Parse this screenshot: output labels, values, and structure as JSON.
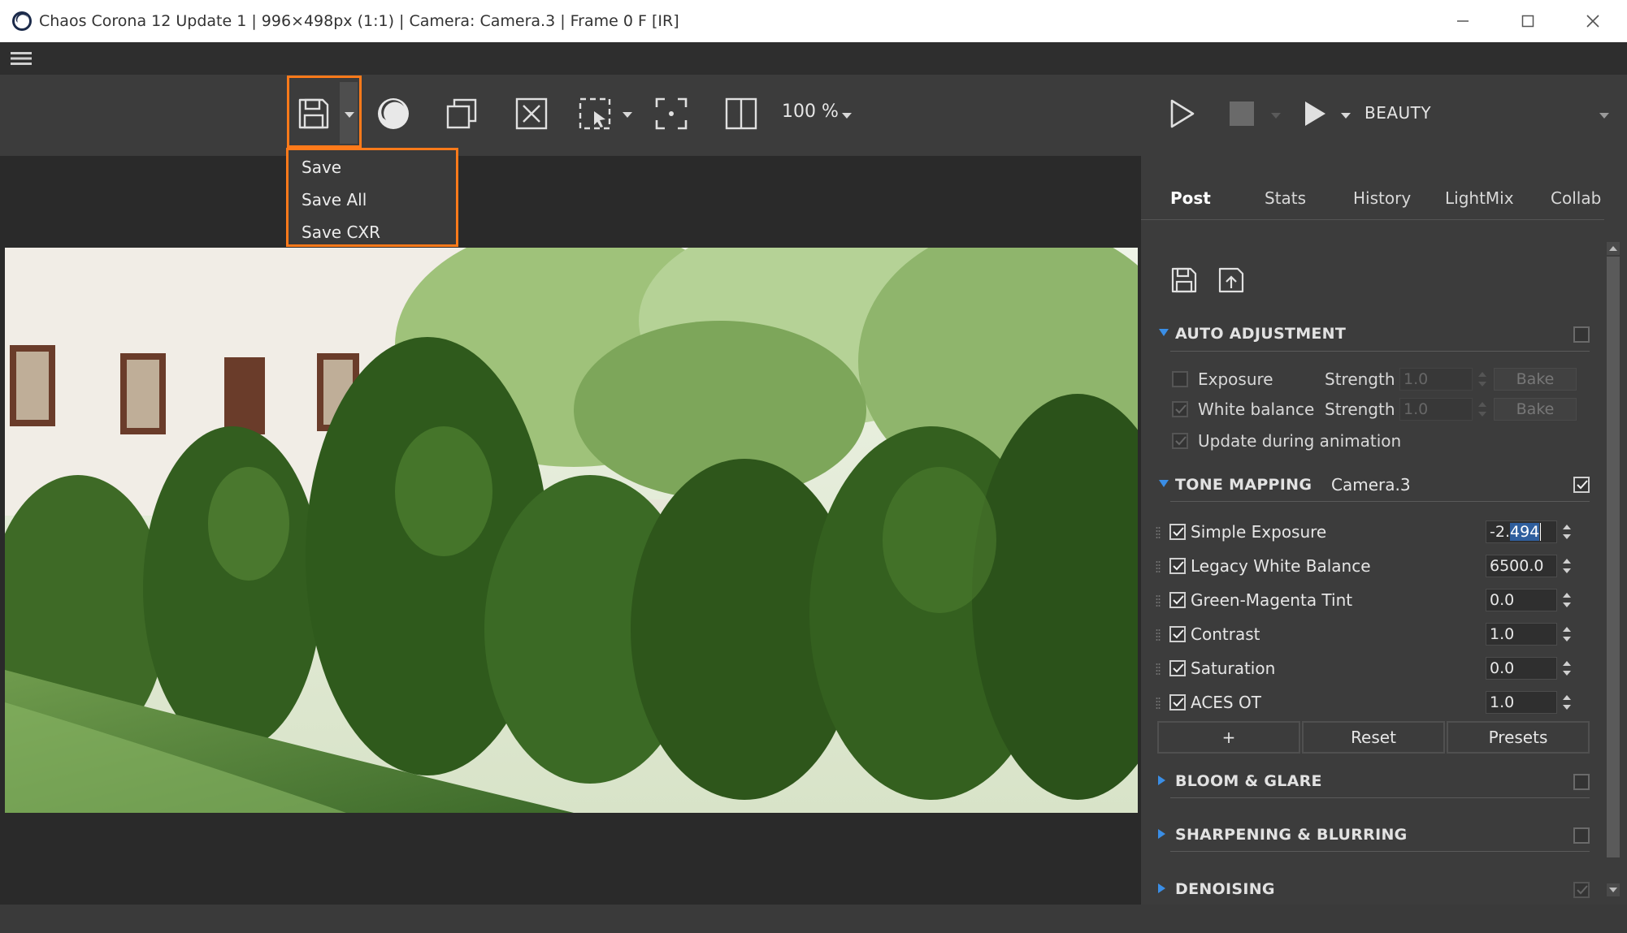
{
  "window": {
    "title": "Chaos Corona 12 Update 1 | 996×498px (1:1) | Camera: Camera.3 | Frame 0 F [IR]"
  },
  "toolbar": {
    "zoom": "100 %",
    "render_element": "BEAUTY"
  },
  "save_menu": {
    "items": [
      "Save",
      "Save All",
      "Save CXR"
    ]
  },
  "panel": {
    "tabs": [
      "Post",
      "Stats",
      "History",
      "LightMix",
      "Collab"
    ],
    "auto_adjustment": {
      "title": "AUTO ADJUSTMENT",
      "exposure_label": "Exposure",
      "white_balance_label": "White balance",
      "strength_label": "Strength",
      "exposure_strength": "1.0",
      "wb_strength": "1.0",
      "bake_label": "Bake",
      "update_label": "Update during animation"
    },
    "tone_mapping": {
      "title": "TONE MAPPING",
      "camera": "Camera.3",
      "operators": [
        {
          "label": "Simple Exposure",
          "value_pre": "-2.",
          "value_sel": "494"
        },
        {
          "label": "Legacy White Balance",
          "value": "6500.0"
        },
        {
          "label": "Green-Magenta Tint",
          "value": "0.0"
        },
        {
          "label": "Contrast",
          "value": "1.0"
        },
        {
          "label": "Saturation",
          "value": "0.0"
        },
        {
          "label": "ACES OT",
          "value": "1.0"
        }
      ],
      "add_label": "+",
      "reset_label": "Reset",
      "presets_label": "Presets"
    },
    "sections": {
      "bloom": "BLOOM & GLARE",
      "sharpen": "SHARPENING & BLURRING",
      "denoise": "DENOISING"
    }
  },
  "colors": {
    "highlight": "#ff7a1a",
    "accent_blue": "#3a8ee6",
    "selection": "#2f5f9e"
  }
}
